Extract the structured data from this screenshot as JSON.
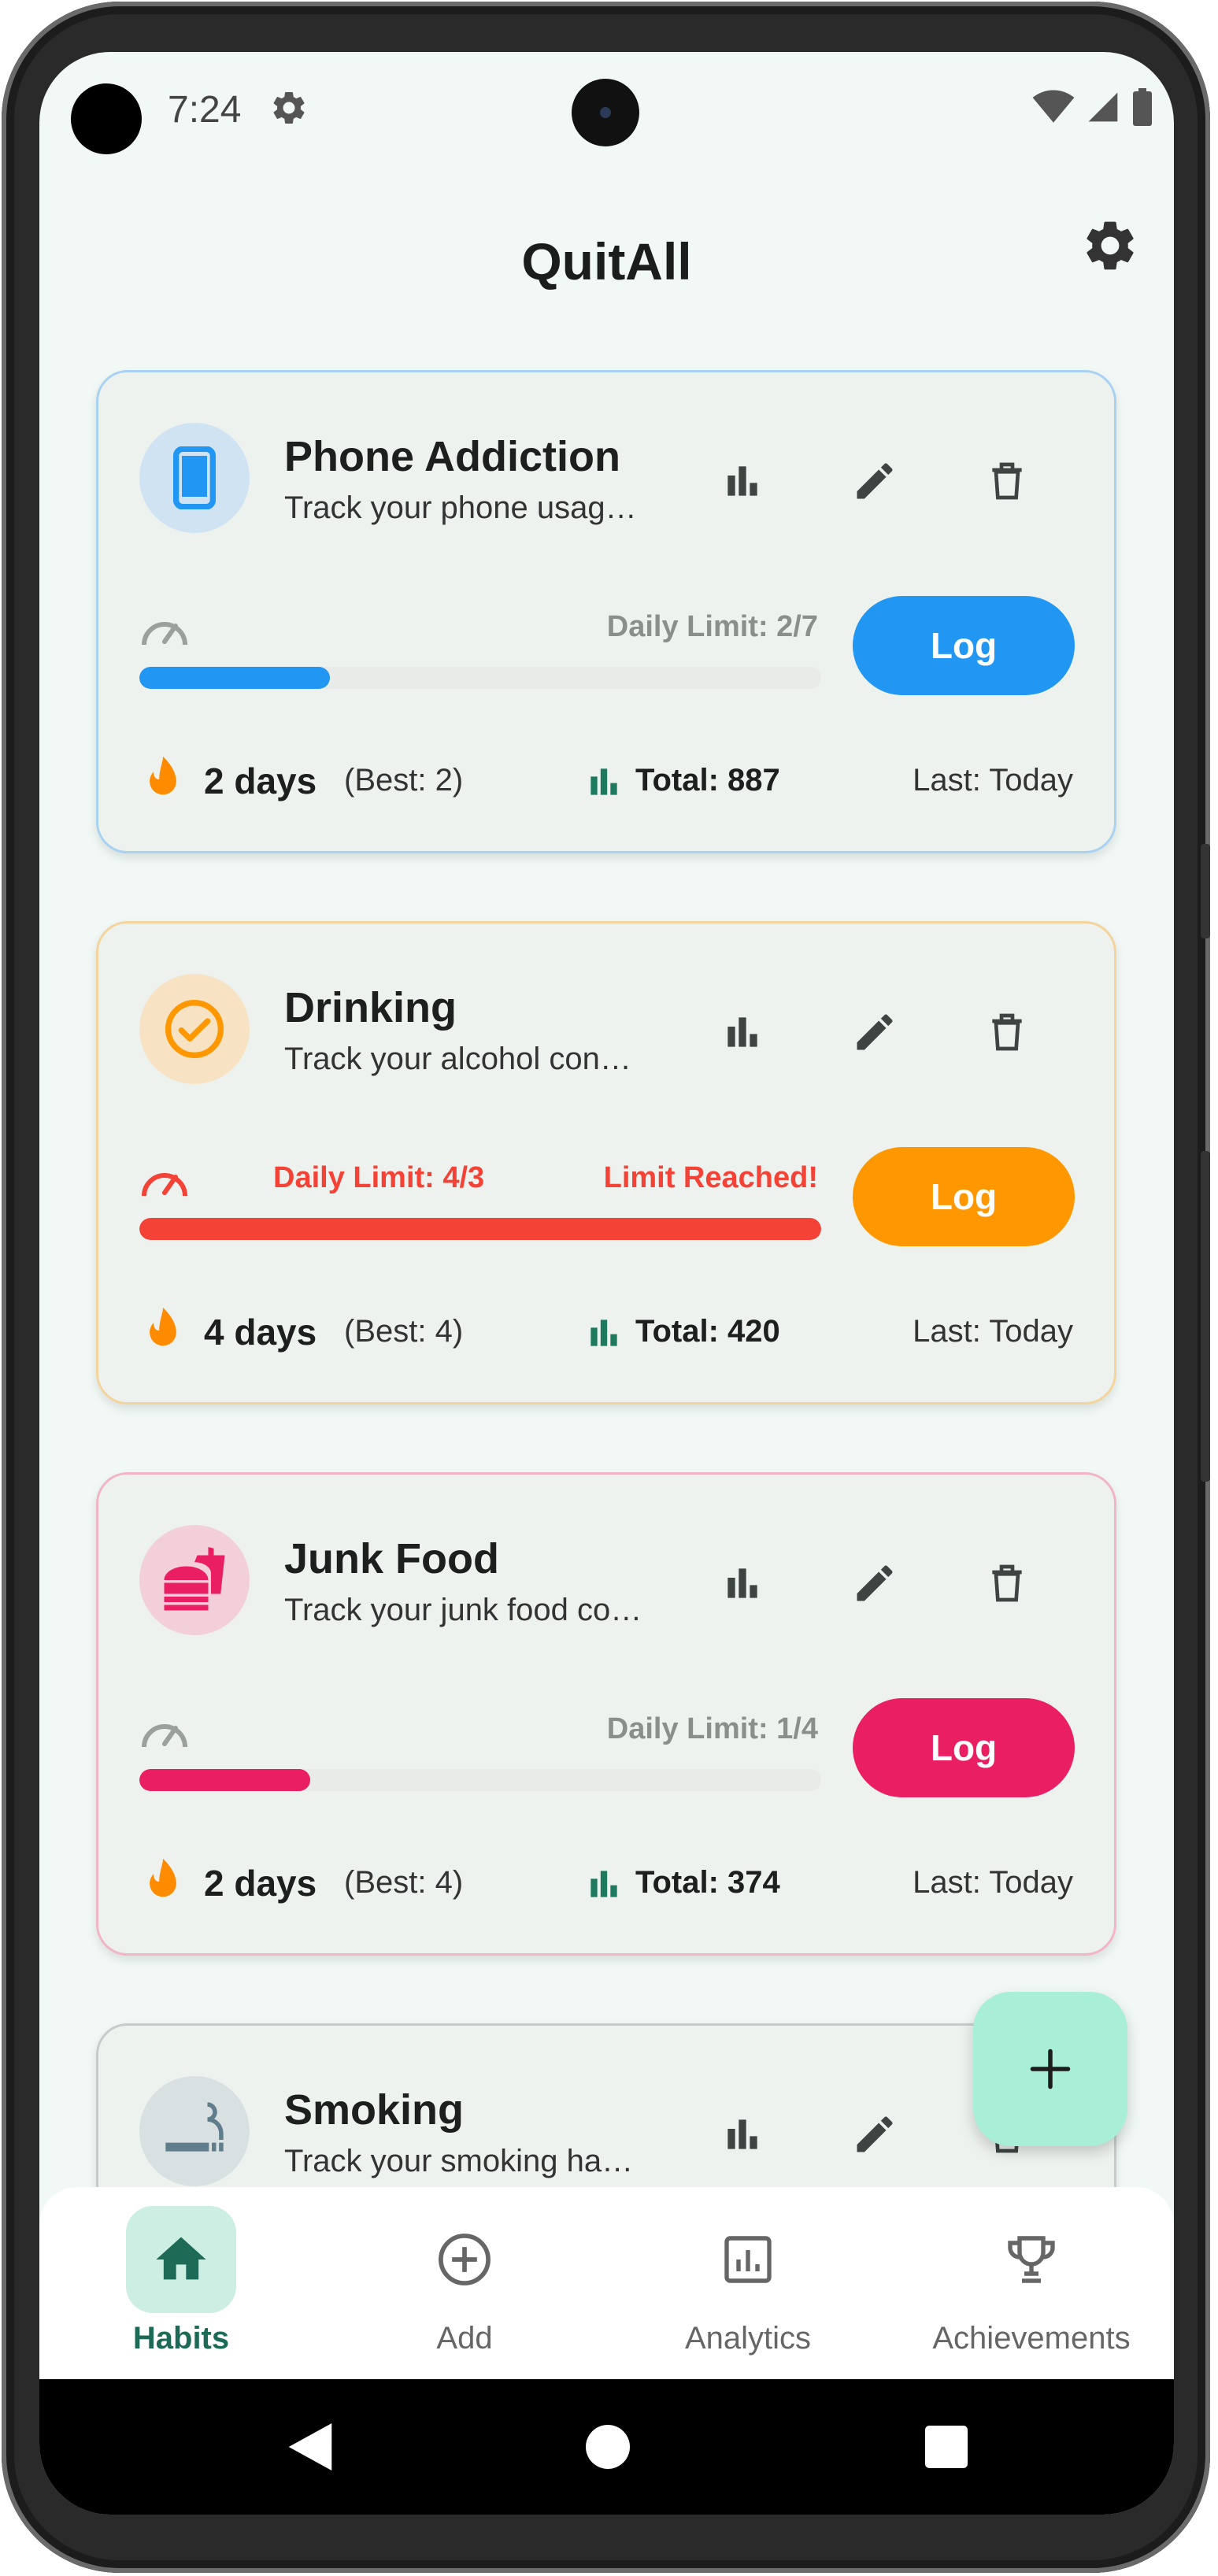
{
  "status_bar": {
    "time": "7:24"
  },
  "header": {
    "title": "QuitAll"
  },
  "log_label": "Log",
  "habits": [
    {
      "name": "Phone Addiction",
      "description": "Track your phone usag…",
      "limit_text": "Daily Limit: 2/7",
      "limit_reached_text": "",
      "progress": 0.28,
      "streak": "2 days",
      "best": "(Best: 2)",
      "total": "Total: 887",
      "last": "Last: Today",
      "accent": "#2196f3",
      "border": "#a9d2f2",
      "icon_bg": "#cfe3f3",
      "icon": "phone-icon"
    },
    {
      "name": "Drinking",
      "description": "Track your alcohol con…",
      "limit_text": "Daily Limit: 4/3",
      "limit_reached_text": "Limit Reached!",
      "progress": 1.0,
      "streak": "4 days",
      "best": "(Best: 4)",
      "total": "Total: 420",
      "last": "Last: Today",
      "accent": "#ff9800",
      "border": "#f4d49c",
      "icon_bg": "#f7e3c3",
      "icon": "check-circle-icon"
    },
    {
      "name": "Junk Food",
      "description": "Track your junk food co…",
      "limit_text": "Daily Limit: 1/4",
      "limit_reached_text": "",
      "progress": 0.25,
      "streak": "2 days",
      "best": "(Best: 4)",
      "total": "Total: 374",
      "last": "Last: Today",
      "accent": "#e91e63",
      "border": "#f2b4c7",
      "icon_bg": "#f3cfda",
      "icon": "fastfood-icon"
    },
    {
      "name": "Smoking",
      "description": "Track your smoking ha…",
      "accent": "#607d8b",
      "border": "#c7cccb",
      "icon_bg": "#d9e0e2",
      "icon": "smoking-icon"
    }
  ],
  "colors": {
    "limit_exceeded": "#f44336",
    "stat_green": "#1d7a5f",
    "fire_orange": "#ff8c00",
    "fab_bg": "#a9eed6",
    "nav_active": "#1d6b57"
  },
  "nav": {
    "items": [
      {
        "label": "Habits",
        "icon": "home-icon",
        "active": true
      },
      {
        "label": "Add",
        "icon": "add-circle-icon",
        "active": false
      },
      {
        "label": "Analytics",
        "icon": "analytics-icon",
        "active": false
      },
      {
        "label": "Achievements",
        "icon": "trophy-icon",
        "active": false
      }
    ]
  }
}
